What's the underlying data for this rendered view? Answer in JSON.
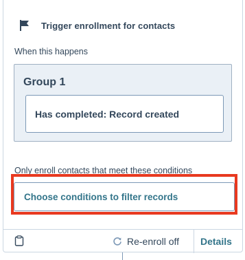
{
  "header": {
    "icon": "flag-icon",
    "title": "Trigger enrollment for contacts"
  },
  "trigger": {
    "label": "When this happens",
    "group": {
      "title": "Group 1",
      "criteria": "Has completed: Record created"
    }
  },
  "conditions": {
    "label": "Only enroll contacts that meet these conditions",
    "button_label": "Choose conditions to filter records"
  },
  "footer": {
    "clipboard_icon": "clipboard-icon",
    "reenroll_icon": "refresh-icon",
    "reenroll_label": "Re-enroll off",
    "details_label": "Details"
  },
  "colors": {
    "text": "#33475b",
    "link": "#33758a",
    "group_background": "#eaf0f6",
    "highlight": "#e8391f",
    "border": "#cbd6e2"
  }
}
